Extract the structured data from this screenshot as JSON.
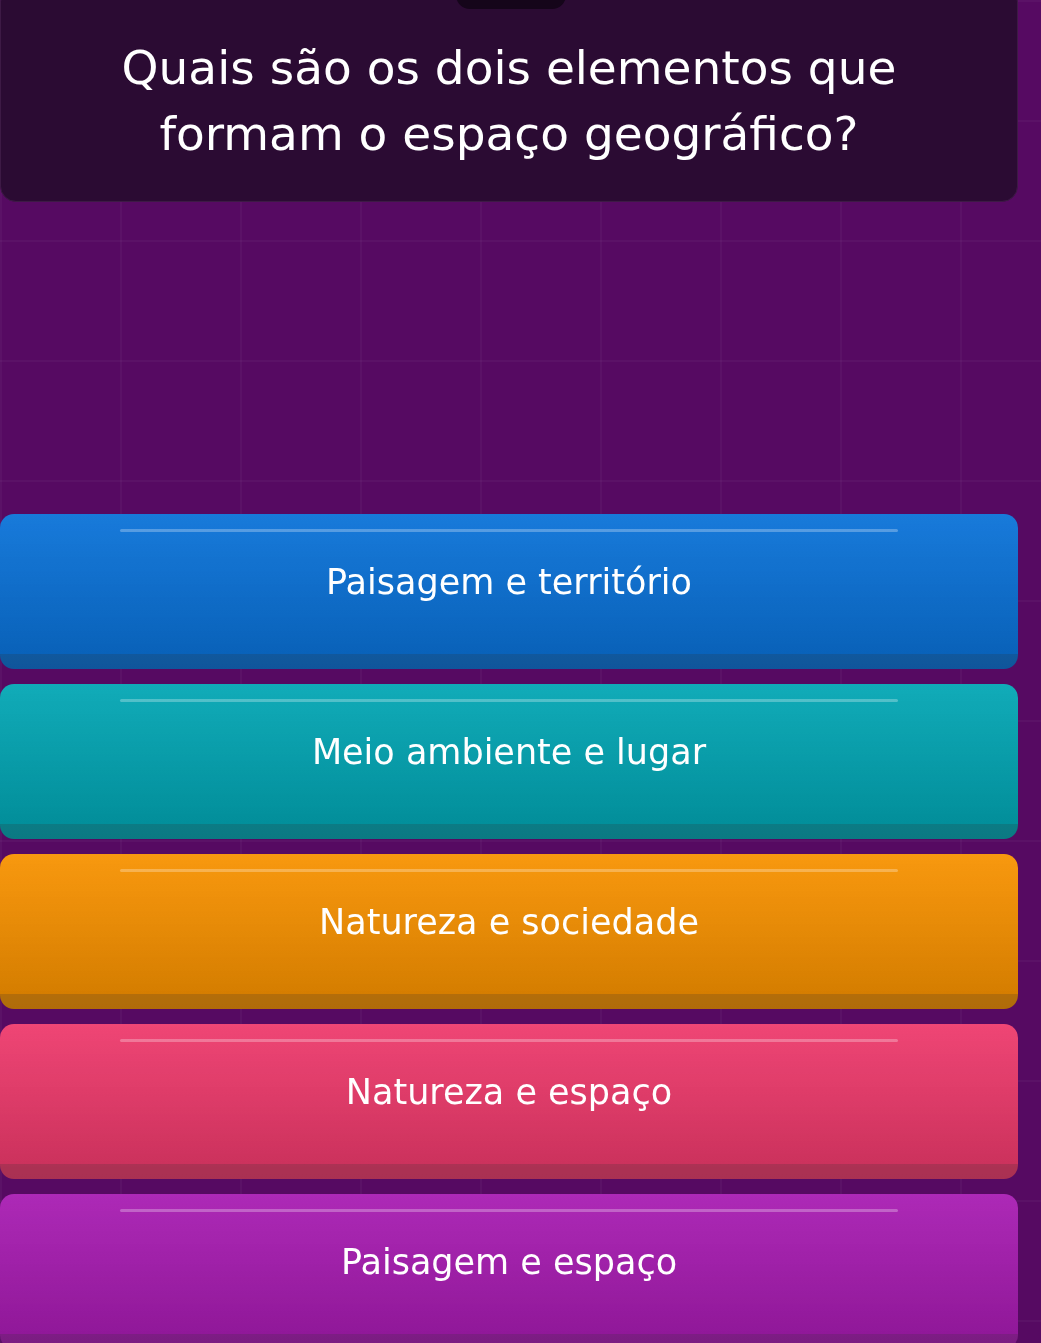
{
  "question": {
    "text": "Quais são os dois elementos que formam o espaço geográfico?"
  },
  "options": [
    {
      "label": "Paisagem e território",
      "color": "#0a72d8"
    },
    {
      "label": "Meio ambiente e lugar",
      "color": "#02a6b4"
    },
    {
      "label": "Natureza e sociedade",
      "color": "#f89200"
    },
    {
      "label": "Natureza e espaço",
      "color": "#ee3a6c"
    },
    {
      "label": "Paisagem e espaço",
      "color": "#a81cb2"
    }
  ]
}
